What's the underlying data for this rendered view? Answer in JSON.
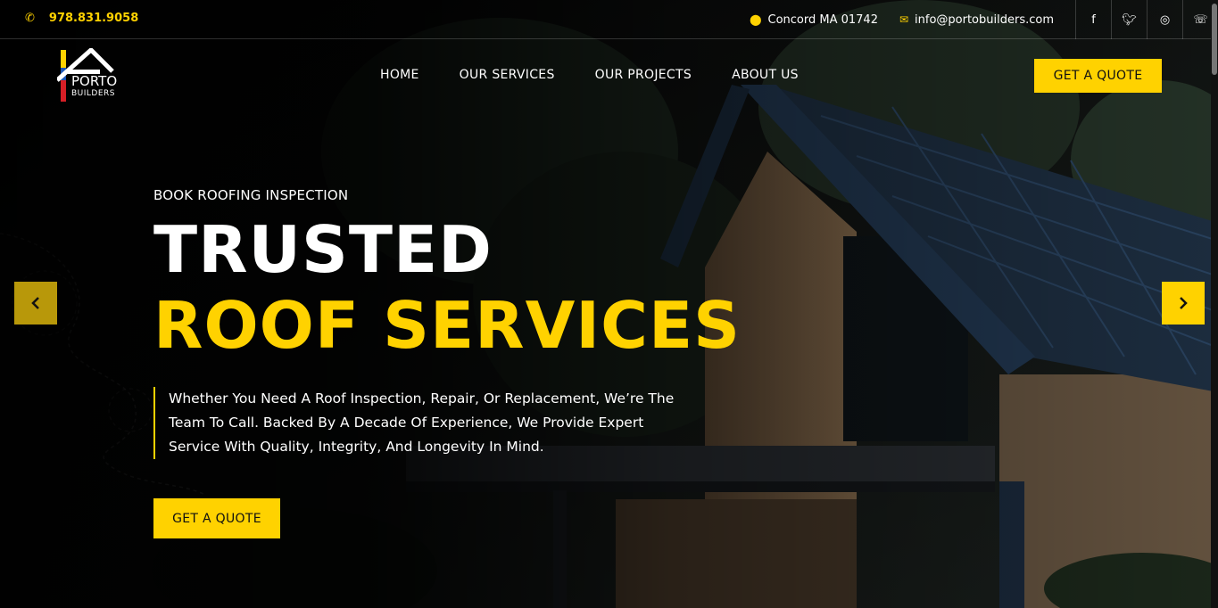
{
  "topbar": {
    "phone": "978.831.9058",
    "location": "Concord MA 01742",
    "email": "info@portobuilders.com",
    "social": [
      "facebook-icon",
      "twitter-icon",
      "instagram-icon",
      "whatsapp-icon"
    ]
  },
  "logo": {
    "name": "PORTO",
    "sub": "BUILDERS"
  },
  "nav": {
    "items": [
      "HOME",
      "OUR SERVICES",
      "OUR PROJECTS",
      "ABOUT US"
    ],
    "cta": "GET A QUOTE"
  },
  "hero": {
    "kicker": "BOOK ROOFING INSPECTION",
    "title_line1": "TRUSTED",
    "title_line2": "ROOF SERVICES",
    "description": "Whether You Need A Roof Inspection, Repair, Or Replacement, We’re The Team To Call. Backed By A Decade Of Experience, We Provide Expert Service With Quality, Integrity, And Longevity In Mind.",
    "cta": "GET A QUOTE"
  },
  "colors": {
    "accent": "#ffd200",
    "background": "#000000",
    "text": "#ffffff"
  }
}
